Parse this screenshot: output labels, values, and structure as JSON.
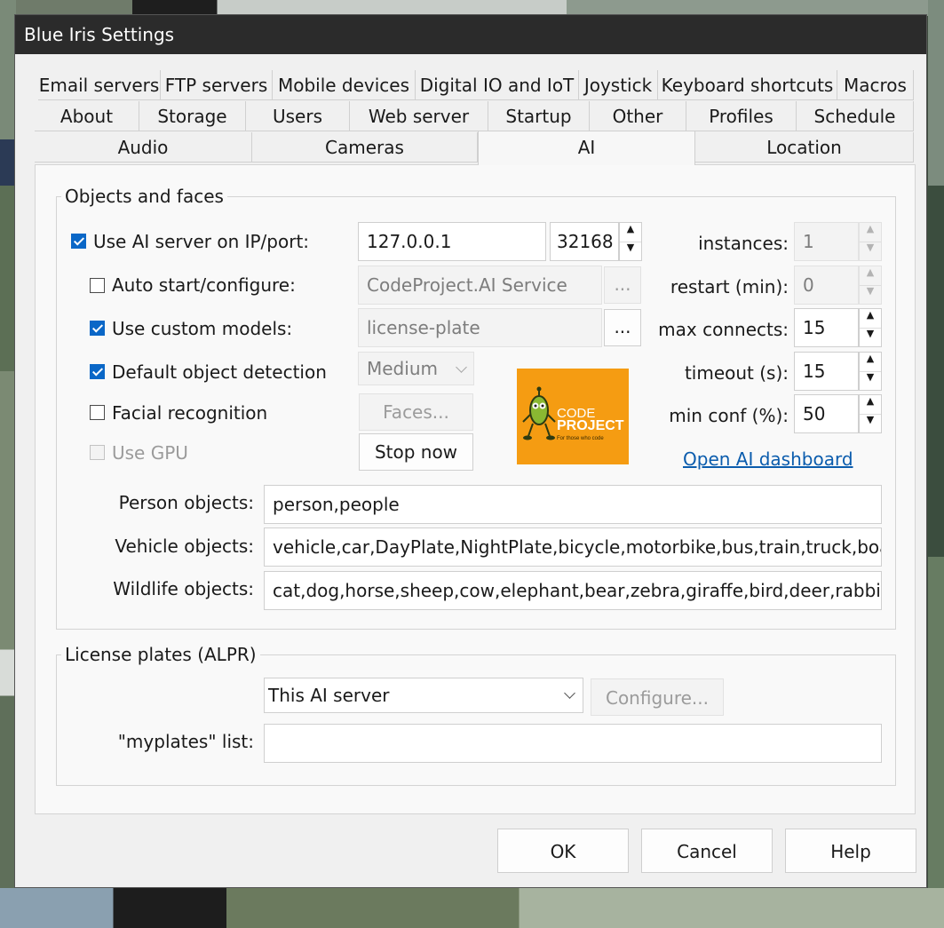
{
  "window": {
    "title": "Blue Iris Settings"
  },
  "tabs": {
    "row1": [
      "Email servers",
      "FTP servers",
      "Mobile devices",
      "Digital IO and IoT",
      "Joystick",
      "Keyboard shortcuts",
      "Macros"
    ],
    "row2": [
      "About",
      "Storage",
      "Users",
      "Web server",
      "Startup",
      "Other",
      "Profiles",
      "Schedule"
    ],
    "row3": [
      "Audio",
      "Cameras",
      "AI",
      "Location"
    ],
    "active": "AI"
  },
  "objects": {
    "group_title": "Objects and faces",
    "use_ai_server": {
      "label": "Use AI server on IP/port:",
      "checked": true
    },
    "ip": "127.0.0.1",
    "port": "32168",
    "auto_start": {
      "label": "Auto start/configure:",
      "checked": false,
      "value": "CodeProject.AI Service",
      "button": "..."
    },
    "custom_models": {
      "label": "Use custom models:",
      "checked": true,
      "value": "license-plate",
      "button": "..."
    },
    "default_detection": {
      "label": "Default object detection",
      "checked": true,
      "value": "Medium"
    },
    "facial": {
      "label": "Facial recognition",
      "checked": false,
      "button": "Faces..."
    },
    "gpu": {
      "label": "Use GPU",
      "checked": false
    },
    "stop_button": "Stop now",
    "logo": {
      "brand_line1": "CODE",
      "brand_line2": "PROJECT",
      "tagline": "For those who code"
    },
    "instances": {
      "label": "instances:",
      "value": "1"
    },
    "restart": {
      "label": "restart (min):",
      "value": "0"
    },
    "max_connects": {
      "label": "max connects:",
      "value": "15"
    },
    "timeout": {
      "label": "timeout (s):",
      "value": "15"
    },
    "min_conf": {
      "label": "min conf (%):",
      "value": "50"
    },
    "dashboard_link": "Open AI dashboard",
    "person": {
      "label": "Person objects:",
      "value": "person,people"
    },
    "vehicle": {
      "label": "Vehicle objects:",
      "value": "vehicle,car,DayPlate,NightPlate,bicycle,motorbike,bus,train,truck,boat"
    },
    "wildlife": {
      "label": "Wildlife objects:",
      "value": "cat,dog,horse,sheep,cow,elephant,bear,zebra,giraffe,bird,deer,rabbit,ra"
    }
  },
  "alpr": {
    "group_title": "License plates (ALPR)",
    "server_select": "This AI server",
    "configure_button": "Configure...",
    "myplates_label": "\"myplates\" list:",
    "myplates_value": ""
  },
  "footer": {
    "ok": "OK",
    "cancel": "Cancel",
    "help": "Help"
  },
  "colors": {
    "titlebar": "#2b2b2b",
    "accent": "#0a67c7",
    "link": "#0b5cad",
    "logo_bg": "#f59c12"
  }
}
